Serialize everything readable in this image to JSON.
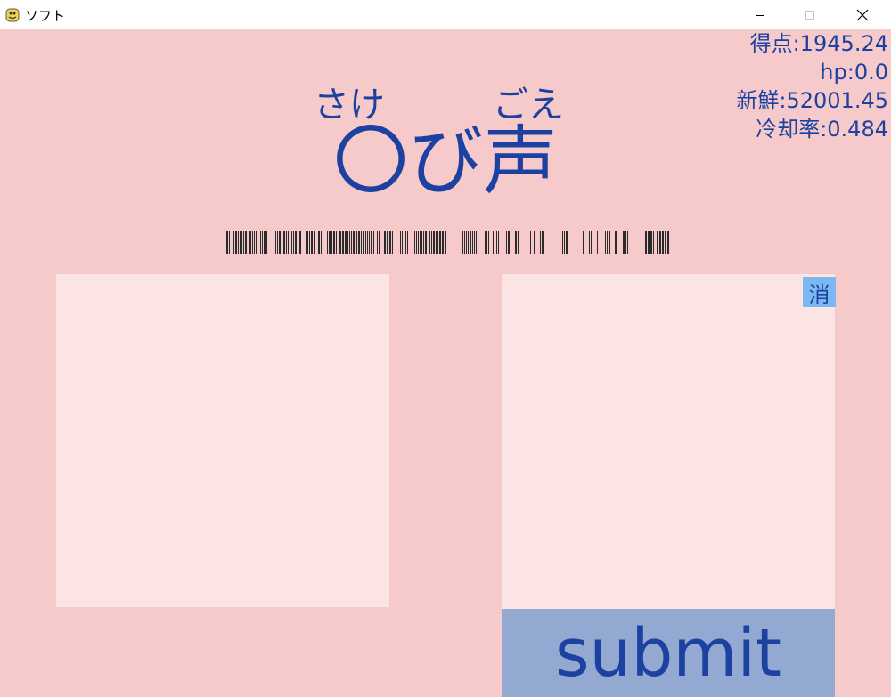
{
  "window": {
    "title": "ソフト",
    "app_icon": "pygame-snake-icon",
    "controls": [
      "minimize",
      "maximize",
      "close"
    ]
  },
  "stats": {
    "score": "得点:1945.24",
    "hp": "hp:0.0",
    "freshness": "新鮮:52001.45",
    "cooling_rate": "冷却率:0.484"
  },
  "heading": {
    "furigana_1": "さけ",
    "furigana_2": "ごえ",
    "title": "〇び声"
  },
  "buttons": {
    "erase": "消",
    "submit": "submit"
  },
  "colors": {
    "background": "#f6caca",
    "panel": "#fde4e4",
    "text": "#1d41a0",
    "erase_button": "#7ab8f2",
    "submit_button": "#94a9d2"
  }
}
